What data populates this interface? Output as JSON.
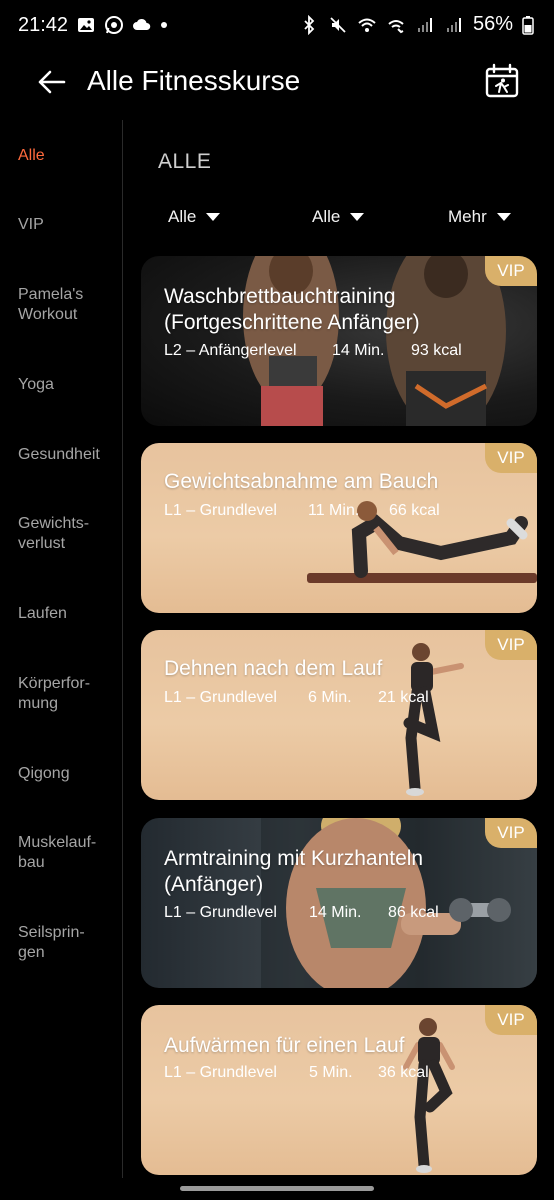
{
  "status_bar": {
    "time": "21:42",
    "battery": "56%"
  },
  "header": {
    "title": "Alle Fitnesskurse"
  },
  "sidebar": {
    "items": [
      {
        "label": "Alle",
        "active": true
      },
      {
        "label": "VIP"
      },
      {
        "label": "Pamela's\nWorkout"
      },
      {
        "label": "Yoga"
      },
      {
        "label": "Gesundheit"
      },
      {
        "label": "Gewichts-\nverlust"
      },
      {
        "label": "Laufen"
      },
      {
        "label": "Körperfor-\nmung"
      },
      {
        "label": "Qigong"
      },
      {
        "label": "Muskelauf-\nbau"
      },
      {
        "label": "Seilsprin-\ngen"
      }
    ]
  },
  "main": {
    "section_title": "ALLE",
    "filters": [
      "Alle",
      "Alle",
      "Mehr"
    ],
    "courses": [
      {
        "title": "Waschbrettbauchtraining (Fortgeschrittene Anfänger)",
        "level": "L2 – Anfängerlevel",
        "duration": "14 Min.",
        "kcal": "93 kcal",
        "badge": "VIP"
      },
      {
        "title": "Gewichtsabnahme am Bauch",
        "level": "L1 – Grundlevel",
        "duration": "11 Min.",
        "kcal": "66 kcal",
        "badge": "VIP"
      },
      {
        "title": "Dehnen nach dem Lauf",
        "level": "L1 – Grundlevel",
        "duration": "6 Min.",
        "kcal": "21 kcal",
        "badge": "VIP"
      },
      {
        "title": "Armtraining mit Kurzhanteln (Anfänger)",
        "level": "L1 – Grundlevel",
        "duration": "14 Min.",
        "kcal": "86 kcal",
        "badge": "VIP"
      },
      {
        "title": "Aufwärmen für einen Lauf",
        "level": "L1 – Grundlevel",
        "duration": "5 Min.",
        "kcal": "36 kcal",
        "badge": "VIP"
      }
    ]
  },
  "colors": {
    "accent": "#ff6a3d",
    "vip": "#d9b06a",
    "card_peach": "#e9c49f"
  }
}
